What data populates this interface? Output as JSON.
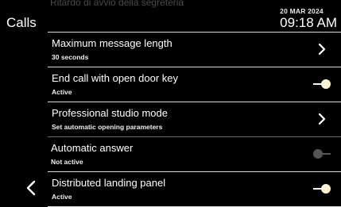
{
  "header": {
    "title": "Calls",
    "ghost_text": "Ritardo di avvio della segreteria",
    "date": "20 MAR 2024",
    "time": "09:18 AM"
  },
  "icons": {
    "back": "chevron-left-icon",
    "navigate": "chevron-right-icon",
    "toggle": "toggle-switch-icon"
  },
  "settings": [
    {
      "title": "Maximum message length",
      "subtitle": "30 seconds",
      "control": "chevron"
    },
    {
      "title": "End call with open door key",
      "subtitle": "Active",
      "control": "toggle",
      "state": "on"
    },
    {
      "title": "Professional studio mode",
      "subtitle": "Set automatic opening parameters",
      "control": "chevron"
    },
    {
      "title": "Automatic answer",
      "subtitle": "Not active",
      "control": "toggle",
      "state": "off"
    },
    {
      "title": "Distributed landing panel",
      "subtitle": "Active",
      "control": "toggle",
      "state": "on"
    }
  ],
  "colors": {
    "background": "#000000",
    "text": "#ffffff",
    "toggle_on_knob": "#fff4d6",
    "toggle_off": "#555555",
    "divider": "#d9d9d9"
  }
}
